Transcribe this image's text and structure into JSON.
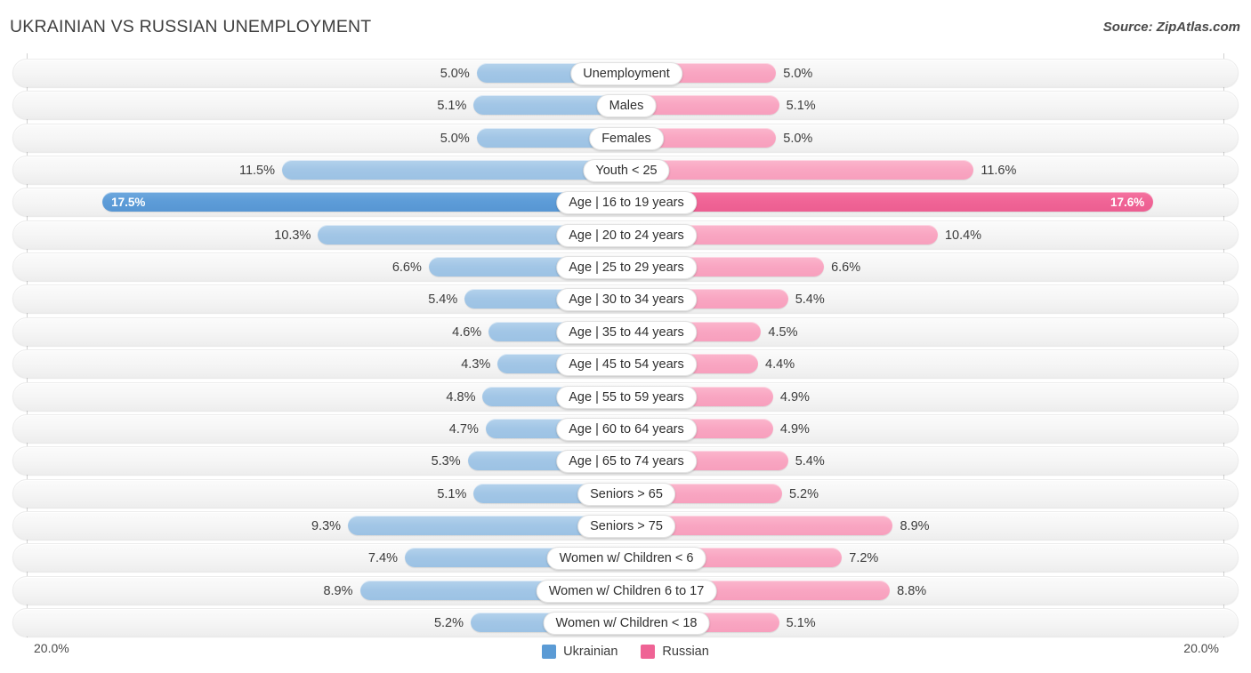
{
  "header": {
    "title": "UKRAINIAN VS RUSSIAN UNEMPLOYMENT",
    "source": "Source: ZipAtlas.com"
  },
  "footer": {
    "axis_left": "20.0%",
    "axis_right": "20.0%",
    "legend": [
      {
        "label": "Ukrainian",
        "color": "#5b9bd5",
        "icon": "square-swatch-icon"
      },
      {
        "label": "Russian",
        "color": "#ef6395",
        "icon": "square-swatch-icon"
      }
    ]
  },
  "chart_data": {
    "type": "bar",
    "subtype": "diverging-butterfly",
    "title": "UKRAINIAN VS RUSSIAN UNEMPLOYMENT",
    "xlabel": "",
    "ylabel": "",
    "xlim": [
      0,
      20
    ],
    "axis_max": 20.0,
    "grid": false,
    "legend_position": "bottom-center",
    "units": "%",
    "categories": [
      "Unemployment",
      "Males",
      "Females",
      "Youth < 25",
      "Age | 16 to 19 years",
      "Age | 20 to 24 years",
      "Age | 25 to 29 years",
      "Age | 30 to 34 years",
      "Age | 35 to 44 years",
      "Age | 45 to 54 years",
      "Age | 55 to 59 years",
      "Age | 60 to 64 years",
      "Age | 65 to 74 years",
      "Seniors > 65",
      "Seniors > 75",
      "Women w/ Children < 6",
      "Women w/ Children 6 to 17",
      "Women w/ Children < 18"
    ],
    "series": [
      {
        "name": "Ukrainian",
        "side": "left",
        "color": "#a2c6e6",
        "highlight_color": "#5d9cd8",
        "values": [
          5.0,
          5.1,
          5.0,
          11.5,
          17.5,
          10.3,
          6.6,
          5.4,
          4.6,
          4.3,
          4.8,
          4.7,
          5.3,
          5.1,
          9.3,
          7.4,
          8.9,
          5.2
        ],
        "labels": [
          "5.0%",
          "5.1%",
          "5.0%",
          "11.5%",
          "17.5%",
          "10.3%",
          "6.6%",
          "5.4%",
          "4.6%",
          "4.3%",
          "4.8%",
          "4.7%",
          "5.3%",
          "5.1%",
          "9.3%",
          "7.4%",
          "8.9%",
          "5.2%"
        ]
      },
      {
        "name": "Russian",
        "side": "right",
        "color": "#f9a6c2",
        "highlight_color": "#f06496",
        "values": [
          5.0,
          5.1,
          5.0,
          11.6,
          17.6,
          10.4,
          6.6,
          5.4,
          4.5,
          4.4,
          4.9,
          4.9,
          5.4,
          5.2,
          8.9,
          7.2,
          8.8,
          5.1
        ],
        "labels": [
          "5.0%",
          "5.1%",
          "5.0%",
          "11.6%",
          "17.6%",
          "10.4%",
          "6.6%",
          "5.4%",
          "4.5%",
          "4.4%",
          "4.9%",
          "4.9%",
          "5.4%",
          "5.2%",
          "8.9%",
          "7.2%",
          "8.8%",
          "5.1%"
        ]
      }
    ],
    "highlight_row_index": 4
  }
}
